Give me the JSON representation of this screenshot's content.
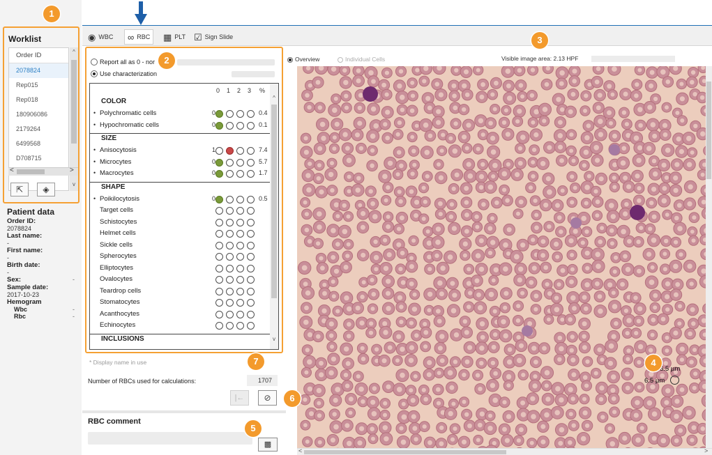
{
  "worklist": {
    "title": "Worklist",
    "header": "Order ID",
    "rows": [
      "2078824",
      "Rep015",
      "Rep018",
      "180906086",
      "2179264",
      "6499568",
      "D708715"
    ],
    "selected_index": 0
  },
  "patient": {
    "title": "Patient data",
    "order_id_label": "Order ID:",
    "order_id": "2078824",
    "last_name_label": "Last name:",
    "last_name": "-",
    "first_name_label": "First name:",
    "first_name": "-",
    "birth_date_label": "Birth date:",
    "birth_date": "-",
    "sex_label": "Sex:",
    "sex": "-",
    "sample_date_label": "Sample date:",
    "sample_date": "2017-10-23",
    "hemogram_label": "Hemogram",
    "wbc_label": "Wbc",
    "rbc_label": "Rbc",
    "wbc_value": "-",
    "rbc_value": "-"
  },
  "toolbar": {
    "tabs": [
      {
        "label": "WBC",
        "icon": "eye-icon"
      },
      {
        "label": "RBC",
        "icon": "rbc-cells-icon"
      },
      {
        "label": "PLT",
        "icon": "plt-grid-icon"
      },
      {
        "label": "Sign Slide",
        "icon": "sign-check-icon"
      }
    ],
    "active_tab": "RBC"
  },
  "characterization": {
    "report_all_label": "Report all as 0 - nor",
    "use_char_label": "Use characterization",
    "use_char_selected": true,
    "scale_headers": [
      "0",
      "1",
      "2",
      "3",
      "%"
    ],
    "sections": [
      {
        "title": "COLOR",
        "rows": [
          {
            "name": "Polychromatic cells",
            "bullet": true,
            "score": "0",
            "level": 0,
            "color": "green",
            "pct": "0.4"
          },
          {
            "name": "Hypochromatic cells",
            "bullet": true,
            "score": "0",
            "level": 0,
            "color": "green",
            "pct": "0.1"
          }
        ]
      },
      {
        "title": "SIZE",
        "rows": [
          {
            "name": "Anisocytosis",
            "bullet": true,
            "score": "1",
            "level": 1,
            "color": "red",
            "pct": "7.4"
          },
          {
            "name": "Microcytes",
            "bullet": true,
            "score": "0",
            "level": 0,
            "color": "green",
            "pct": "5.7"
          },
          {
            "name": "Macrocytes",
            "bullet": true,
            "score": "0",
            "level": 0,
            "color": "green",
            "pct": "1.7"
          }
        ]
      },
      {
        "title": "SHAPE",
        "rows": [
          {
            "name": "Poikilocytosis",
            "bullet": true,
            "score": "0",
            "level": 0,
            "color": "green",
            "pct": "0.5"
          },
          {
            "name": "Target cells",
            "bullet": false,
            "score": "",
            "level": -1,
            "color": "",
            "pct": ""
          },
          {
            "name": "Schistocytes",
            "bullet": false,
            "score": "",
            "level": -1,
            "color": "",
            "pct": ""
          },
          {
            "name": "Helmet cells",
            "bullet": false,
            "score": "",
            "level": -1,
            "color": "",
            "pct": ""
          },
          {
            "name": "Sickle cells",
            "bullet": false,
            "score": "",
            "level": -1,
            "color": "",
            "pct": ""
          },
          {
            "name": "Spherocytes",
            "bullet": false,
            "score": "",
            "level": -1,
            "color": "",
            "pct": ""
          },
          {
            "name": "Elliptocytes",
            "bullet": false,
            "score": "",
            "level": -1,
            "color": "",
            "pct": ""
          },
          {
            "name": "Ovalocytes",
            "bullet": false,
            "score": "",
            "level": -1,
            "color": "",
            "pct": ""
          },
          {
            "name": "Teardrop cells",
            "bullet": false,
            "score": "",
            "level": -1,
            "color": "",
            "pct": ""
          },
          {
            "name": "Stomatocytes",
            "bullet": false,
            "score": "",
            "level": -1,
            "color": "",
            "pct": ""
          },
          {
            "name": "Acanthocytes",
            "bullet": false,
            "score": "",
            "level": -1,
            "color": "",
            "pct": ""
          },
          {
            "name": "Echinocytes",
            "bullet": false,
            "score": "",
            "level": -1,
            "color": "",
            "pct": ""
          }
        ]
      },
      {
        "title": "INCLUSIONS",
        "rows": []
      }
    ]
  },
  "footer": {
    "display_note": "* Display name in use",
    "rbc_count_label": "Number of RBCs used for calculations:",
    "rbc_count": "1707",
    "nav_first_icon": "go-first-icon",
    "cancel_icon": "cancel-circle-icon"
  },
  "comment": {
    "title": "RBC comment",
    "button_icon": "speech-bubble-icon"
  },
  "viewer": {
    "overview_label": "Overview",
    "individual_label": "Individual Cells",
    "overview_selected": true,
    "visible_area": "Visible image area: 2.13 HPF",
    "scale_top": "6.5 µm",
    "scale_bottom": "6.5 µm"
  },
  "callouts": [
    "1",
    "2",
    "3",
    "4",
    "5",
    "6",
    "7"
  ],
  "colors": {
    "accent_orange": "#f39a2c",
    "arrow_blue": "#1e5fa8",
    "indicator_green": "#7a9a3a",
    "indicator_red": "#c94848",
    "selected_blue": "#2b7fc4"
  }
}
